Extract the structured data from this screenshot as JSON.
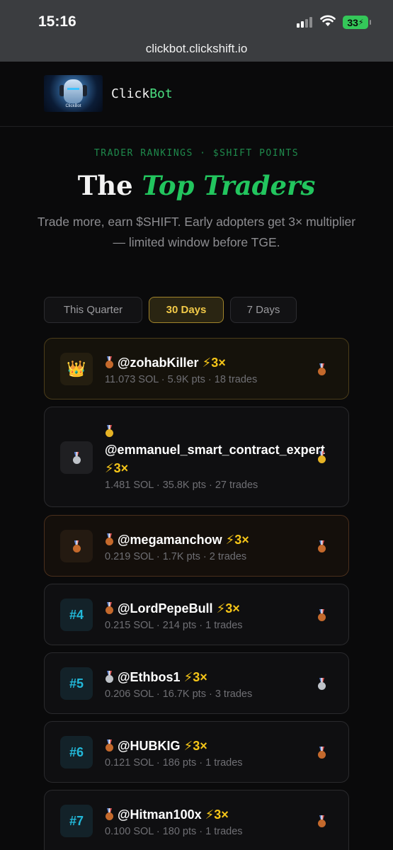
{
  "status_bar": {
    "time": "15:16",
    "battery": "33"
  },
  "browser": {
    "url": "clickbot.clickshift.io"
  },
  "header": {
    "logo_caption": "ClickBot",
    "brand_click": "Click",
    "brand_bot": "Bot"
  },
  "hero": {
    "eyebrow": "TRADER RANKINGS · $SHIFT POINTS",
    "title_plain": "The ",
    "title_accent": "Top Traders",
    "subtitle": "Trade more, earn $SHIFT. Early adopters get 3× multiplier — limited window before TGE."
  },
  "tabs": [
    {
      "label": "This Quarter",
      "active": false
    },
    {
      "label": "30 Days",
      "active": true
    },
    {
      "label": "7 Days",
      "active": false
    }
  ],
  "traders": [
    {
      "rank": 1,
      "rank_label": "",
      "name": "@zohabKiller",
      "multiplier": "⚡3×",
      "sol": "11.073 SOL",
      "pts": "5.9K pts",
      "trades": "18 trades",
      "medal": "bronze",
      "badge": "crown-icon"
    },
    {
      "rank": 2,
      "rank_label": "",
      "name": "@emmanuel_smart_contract_expert",
      "multiplier": "⚡3×",
      "sol": "1.481 SOL",
      "pts": "35.8K pts",
      "trades": "27 trades",
      "medal": "gold",
      "badge": "silver-medal-icon"
    },
    {
      "rank": 3,
      "rank_label": "",
      "name": "@megamanchow",
      "multiplier": "⚡3×",
      "sol": "0.219 SOL",
      "pts": "1.7K pts",
      "trades": "2 trades",
      "medal": "bronze",
      "badge": "bronze-medal-icon"
    },
    {
      "rank": 4,
      "rank_label": "#4",
      "name": "@LordPepeBull",
      "multiplier": "⚡3×",
      "sol": "0.215 SOL",
      "pts": "214 pts",
      "trades": "1 trades",
      "medal": "bronze"
    },
    {
      "rank": 5,
      "rank_label": "#5",
      "name": "@Ethbos1",
      "multiplier": "⚡3×",
      "sol": "0.206 SOL",
      "pts": "16.7K pts",
      "trades": "3 trades",
      "medal": "silver"
    },
    {
      "rank": 6,
      "rank_label": "#6",
      "name": "@HUBKIG",
      "multiplier": "⚡3×",
      "sol": "0.121 SOL",
      "pts": "186 pts",
      "trades": "1 trades",
      "medal": "bronze"
    },
    {
      "rank": 7,
      "rank_label": "#7",
      "name": "@Hitman100x",
      "multiplier": "⚡3×",
      "sol": "0.100 SOL",
      "pts": "180 pts",
      "trades": "1 trades",
      "medal": "bronze"
    }
  ],
  "colors": {
    "accent_green": "#22c55e",
    "gold": "#f1c948",
    "rank_cyan": "#22b8d9"
  }
}
